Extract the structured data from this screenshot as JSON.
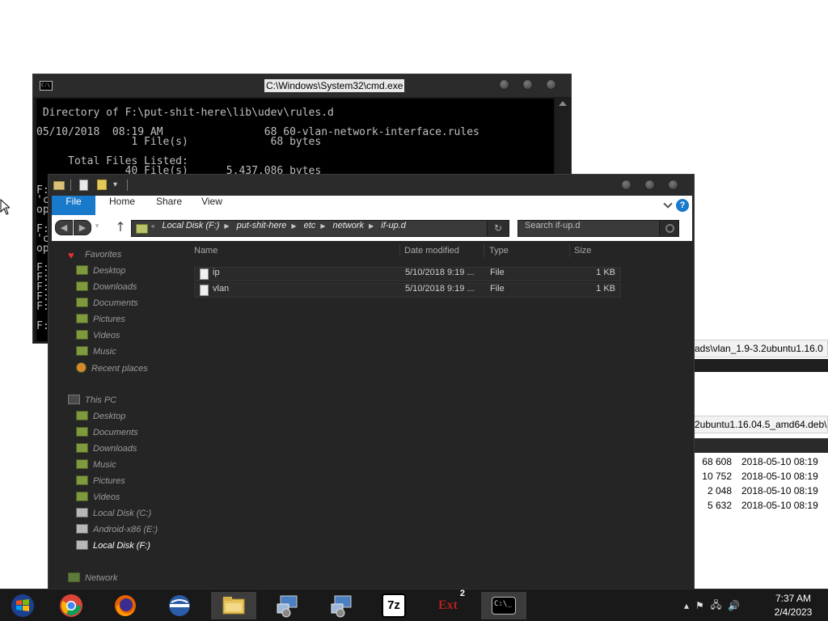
{
  "bg_window": {
    "path_top": "ads\\vlan_1.9-3.2ubuntu1.16.0",
    "path_mid": "2ubuntu1.16.04.5_amd64.deb\\d",
    "rows": [
      {
        "size": "68 608",
        "date": "2018-05-10 08:19"
      },
      {
        "size": "10 752",
        "date": "2018-05-10 08:19"
      },
      {
        "size": "2 048",
        "date": "2018-05-10 08:19"
      },
      {
        "size": "5 632",
        "date": "2018-05-10 08:19"
      }
    ]
  },
  "cmd": {
    "title": "C:\\Windows\\System32\\cmd.exe",
    "icon_text": "C:\\",
    "lines": [
      "",
      " Directory of F:\\put-shit-here\\lib\\udev\\rules.d",
      "",
      "05/10/2018  08:19 AM                68 60-vlan-network-interface.rules",
      "               1 File(s)             68 bytes",
      "",
      "     Total Files Listed:",
      "              40 File(s)      5,437,086 bytes",
      "",
      "F:",
      "'c",
      "op",
      "",
      "F:",
      "'c",
      "op",
      "",
      "F:",
      "F:",
      "F:",
      "F:",
      "F:",
      "",
      "F:"
    ]
  },
  "explorer": {
    "ribbon_tabs": [
      "File",
      "Home",
      "Share",
      "View"
    ],
    "help": "?",
    "address": [
      "Local Disk (F:)",
      "put-shit-here",
      "etc",
      "network",
      "if-up.d"
    ],
    "address_prefix": "«",
    "search_placeholder": "Search if-up.d",
    "columns": [
      "Name",
      "Date modified",
      "Type",
      "Size"
    ],
    "files": [
      {
        "name": "ip",
        "date": "5/10/2018 9:19 ...",
        "type": "File",
        "size": "1 KB"
      },
      {
        "name": "vlan",
        "date": "5/10/2018 9:19 ...",
        "type": "File",
        "size": "1 KB"
      }
    ],
    "sidebar": {
      "favorites": "Favorites",
      "fav_items": [
        "Desktop",
        "Downloads",
        "Documents",
        "Pictures",
        "Videos",
        "Music",
        "Recent places"
      ],
      "this_pc": "This PC",
      "pc_items": [
        "Desktop",
        "Documents",
        "Downloads",
        "Music",
        "Pictures",
        "Videos",
        "Local Disk (C:)",
        "Android-x86 (E:)",
        "Local Disk (F:)"
      ],
      "network": "Network"
    }
  },
  "taskbar": {
    "items": [
      "chrome",
      "firefox",
      "opera",
      "file-explorer",
      "remote-desktop",
      "remote-desktop-2",
      "7zip",
      "ext2",
      "cmd"
    ],
    "sevenzip_label": "7z",
    "ext_label": "Ext",
    "ext_badge": "2",
    "cmd_label": "C:\\_",
    "time": "7:37 AM",
    "date": "2/4/2023"
  },
  "colors": {
    "accent": "#1979ca",
    "window_dark": "#252525",
    "taskbar": "#191919"
  }
}
